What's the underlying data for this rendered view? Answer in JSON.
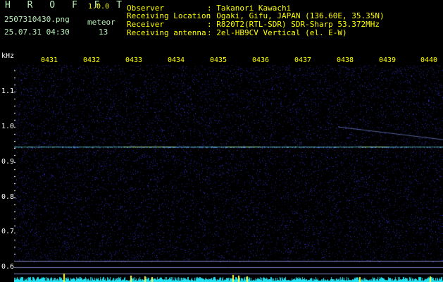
{
  "header": {
    "app_title": "H R O F F T",
    "app_version": "1.0.0",
    "filename": "2507310430.png",
    "datetime": "25.07.31 04:30",
    "event_type": "meteor",
    "event_count": "13",
    "info": [
      {
        "label": "Observer",
        "value": ": Takanori Kawachi"
      },
      {
        "label": "Receiving Location",
        "value": ": Ogaki, Gifu, JAPAN (136.60E, 35.35N)"
      },
      {
        "label": "Receiver",
        "value": ": R820T2(RTL-SDR) SDR-Sharp 53.372MHz"
      },
      {
        "label": "Receiving antenna",
        "value": ": 2el-HB9CV Vertical (el. E-W)"
      }
    ]
  },
  "x_axis": {
    "ticks": [
      "0431",
      "0432",
      "0433",
      "0434",
      "0435",
      "0436",
      "0437",
      "0438",
      "0439",
      "0440"
    ]
  },
  "y_axis": {
    "unit": "kHz",
    "ticks": [
      "1.1",
      "1.0",
      "0.9",
      "0.8",
      "0.7",
      "0.6"
    ]
  },
  "colors": {
    "background": "#000000",
    "noise_low": "#0a0a5a",
    "noise_high": "#3a3ad0",
    "signal": "#80ffff",
    "signal_hot": "#ffff40",
    "baseline": "#20e0f0",
    "ref_line": "#8080c0"
  }
}
